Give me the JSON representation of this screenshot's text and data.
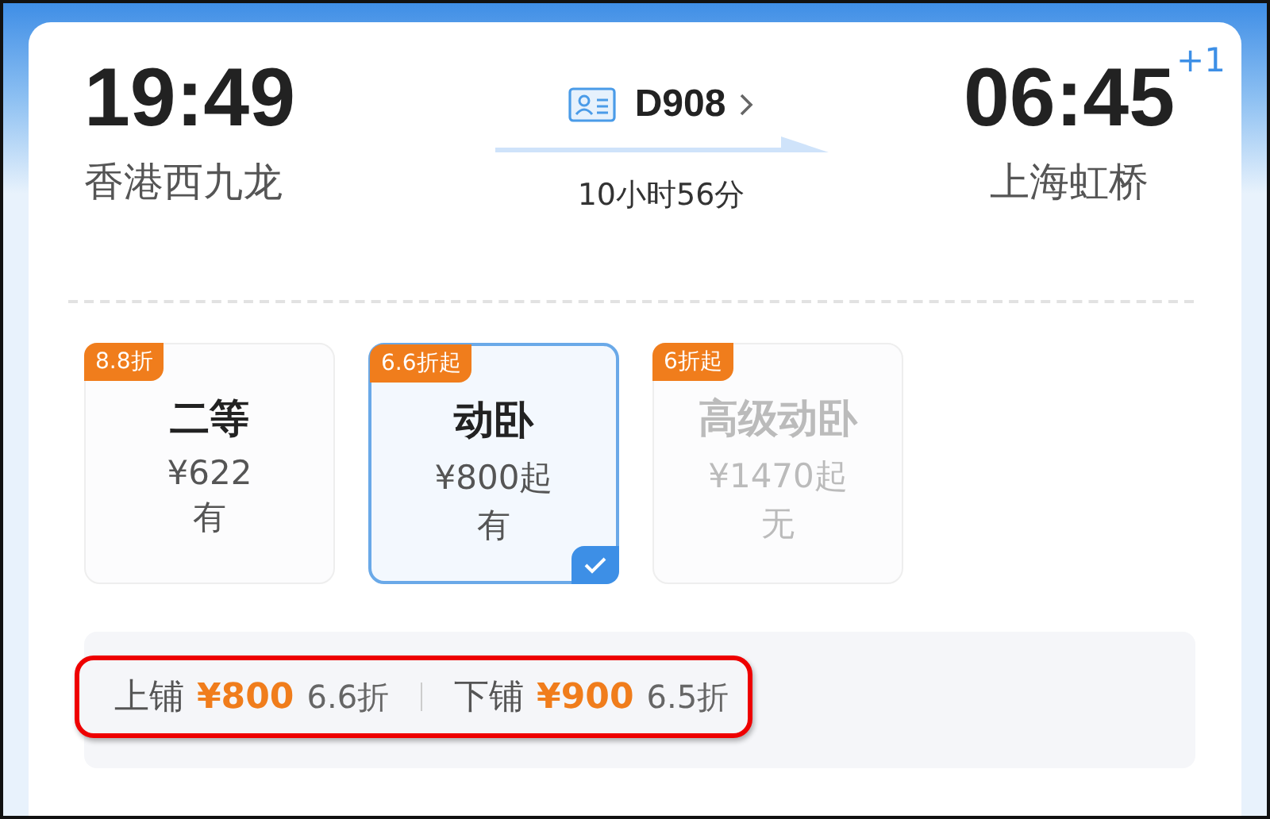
{
  "departure": {
    "time": "19:49",
    "station": "香港西九龙"
  },
  "train": {
    "number": "D908",
    "duration": "10小时56分"
  },
  "arrival": {
    "time": "06:45",
    "station": "上海虹桥",
    "day_offset": "+1"
  },
  "seats": [
    {
      "badge": "8.8折",
      "name": "二等",
      "price": "¥622",
      "availability": "有",
      "available": true,
      "selected": false
    },
    {
      "badge": "6.6折起",
      "name": "动卧",
      "price": "¥800起",
      "availability": "有",
      "available": true,
      "selected": true
    },
    {
      "badge": "6折起",
      "name": "高级动卧",
      "price": "¥1470起",
      "availability": "无",
      "available": false,
      "selected": false
    }
  ],
  "berths": [
    {
      "name": "上铺",
      "price": "¥800",
      "discount": "6.6折"
    },
    {
      "name": "下铺",
      "price": "¥900",
      "discount": "6.5折"
    }
  ]
}
